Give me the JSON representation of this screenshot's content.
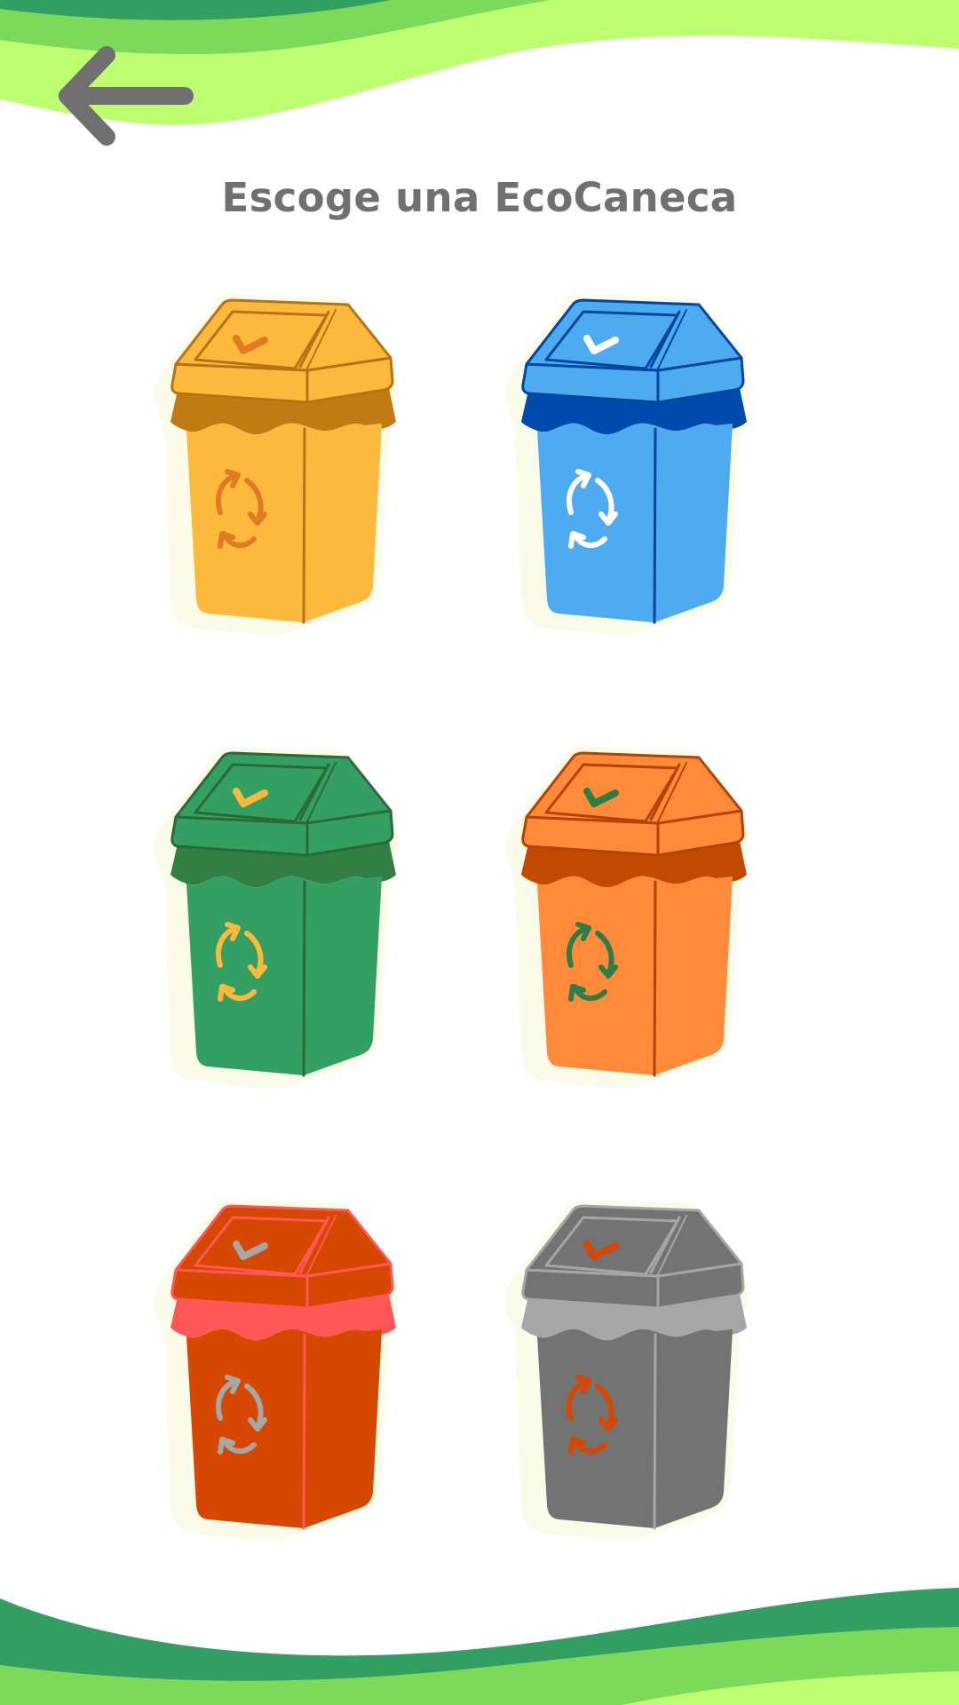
{
  "screen": {
    "title": "Escoge una EcoCaneca",
    "back_icon": "arrow-left-icon"
  },
  "theme": {
    "background": "#ffffff",
    "title_color": "#707070",
    "back_arrow_color": "#707070",
    "wave_dark_green": "#339e62",
    "wave_mid_green": "#7cd95a",
    "wave_light_green": "#bdff70",
    "sticker_outline": "#fbfbe9"
  },
  "bins": [
    {
      "color_name": "yellow",
      "body": "#fdb93c",
      "dark": "#c27b14",
      "line": "#b57316",
      "symbol": "#e07b24",
      "check": "#e07b24"
    },
    {
      "color_name": "blue",
      "body": "#4fabef",
      "dark": "#004aad",
      "line": "#0046a0",
      "symbol": "#ffffff",
      "check": "#ffffff"
    },
    {
      "color_name": "green",
      "body": "#349f63",
      "dark": "#327e44",
      "line": "#2a6a3a",
      "symbol": "#fdb93c",
      "check": "#fdb93c"
    },
    {
      "color_name": "orange",
      "body": "#ff8a3a",
      "dark": "#c24a00",
      "line": "#b04400",
      "symbol": "#2e7d46",
      "check": "#2e7d46"
    },
    {
      "color_name": "red",
      "body": "#d64700",
      "dark": "#ff5757",
      "line": "#ff5757",
      "symbol": "#a6a6a6",
      "check": "#a6a6a6"
    },
    {
      "color_name": "gray",
      "body": "#737373",
      "dark": "#a6a6a6",
      "line": "#a6a6a6",
      "symbol": "#d64700",
      "check": "#d64700"
    }
  ]
}
